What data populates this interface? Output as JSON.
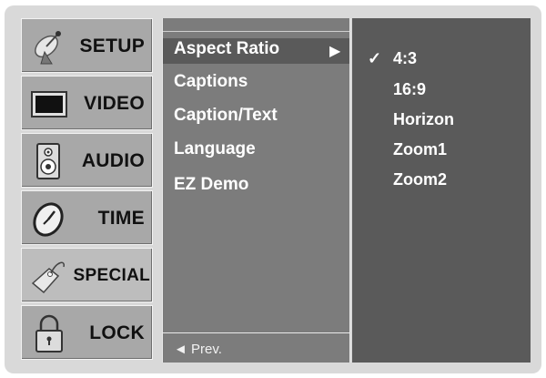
{
  "menu": {
    "tabs": [
      {
        "label": "SETUP",
        "icon": "satellite-dish-icon"
      },
      {
        "label": "VIDEO",
        "icon": "tv-screen-icon"
      },
      {
        "label": "AUDIO",
        "icon": "speaker-icon"
      },
      {
        "label": "TIME",
        "icon": "clock-icon"
      },
      {
        "label": "SPECIAL",
        "icon": "tag-icon"
      },
      {
        "label": "LOCK",
        "icon": "padlock-icon"
      }
    ],
    "active_tab": "SPECIAL"
  },
  "submenu": {
    "items": [
      "Aspect Ratio",
      "Captions",
      "Caption/Text",
      "Language",
      "EZ Demo"
    ],
    "selected": "Aspect Ratio",
    "prev_label": "◄ Prev."
  },
  "options": {
    "items": [
      "4:3",
      "16:9",
      "Horizon",
      "Zoom1",
      "Zoom2"
    ],
    "checked": "4:3"
  },
  "colors": {
    "frame": "#d9d9d9",
    "tab": "#a8a8a8",
    "submenu_bg": "#7c7c7c",
    "options_bg": "#5a5a5a",
    "text": "#ffffff"
  }
}
